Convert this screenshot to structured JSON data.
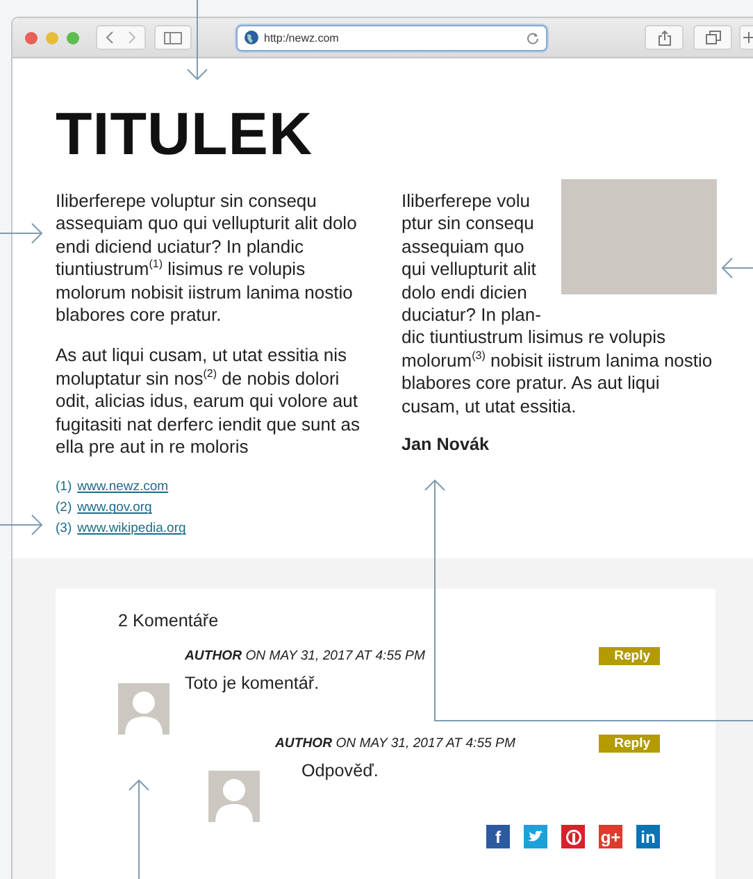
{
  "browser": {
    "url": "http:/newz.com"
  },
  "article": {
    "title": "TITULEK",
    "left_paragraphs": [
      "Iliberferepe voluptur sin consequ assequiam quo qui vellupturit alit dolo endi diciend uciatur? In plandic tiuntiustrum$^{(1)}$ lisimus re volupis molorum nobisit iistrum lanima nostio blabores core pratur.",
      "As aut liqui cusam, ut utat essitia nis moluptatur sin nos$^{(2)}$ de nobis dolori odit, alicias idus, earum qui volore aut fugitasiti nat derferc iendit que sunt as ella pre aut in re moloris"
    ],
    "footnotes": [
      {
        "number": "(1)",
        "link": "www.newz.com"
      },
      {
        "number": "(2)",
        "link": "www.gov.org"
      },
      {
        "number": "(3)",
        "link": "www.wikipedia.org"
      }
    ],
    "right_paragraphs": [
      "Iliberferepe volu ptur sin consequ assequiam quo qui vellupturit alit dolo endi dicien duciatur? In plan-",
      "dic tiuntiustrum lisimus re volupis molorum$^{(3)}$ nobisit iistrum lanima nostio blabores core pratur. As aut liqui cusam, ut utat essitia."
    ],
    "author": "Jan Novák"
  },
  "comments": {
    "heading": "2 Komentáře",
    "items": [
      {
        "author": "AUTHOR",
        "date": "ON MAY 31, 2017 AT 4:55 PM",
        "text": "Toto je komentář.",
        "reply": "Reply",
        "children": [
          {
            "author": "AUTHOR",
            "date": "ON MAY 31, 2017 AT 4:55 PM",
            "text": "Odpověď.",
            "reply": "Reply"
          }
        ]
      }
    ]
  },
  "social": [
    {
      "kind": "facebook",
      "label": "f",
      "color": "#2c5aa0"
    },
    {
      "kind": "twitter",
      "color": "#1da1db"
    },
    {
      "kind": "pinterest",
      "color": "#d7222b"
    },
    {
      "kind": "google",
      "label": "g+",
      "color": "#dd3b2e"
    },
    {
      "kind": "linkedin",
      "label": "in",
      "color": "#0b74b3"
    }
  ]
}
